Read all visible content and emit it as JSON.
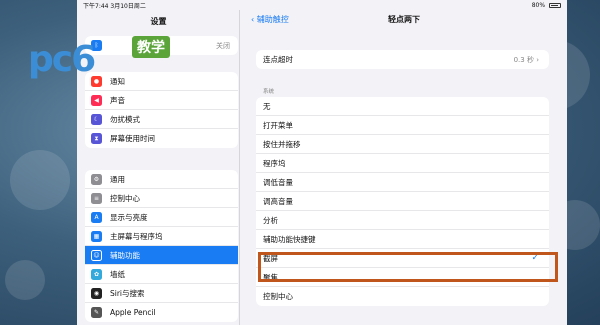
{
  "status": {
    "time": "下午7:44",
    "date": "3月10日周二",
    "battery": "80%"
  },
  "left": {
    "title": "设置",
    "bluetooth": {
      "value": "关闭"
    },
    "group1": [
      {
        "label": "通知",
        "icon": "bell-icon",
        "color": "#ff3b30"
      },
      {
        "label": "声音",
        "icon": "speaker-icon",
        "color": "#ff2d55"
      },
      {
        "label": "勿扰模式",
        "icon": "moon-icon",
        "color": "#5856d6"
      },
      {
        "label": "屏幕使用时间",
        "icon": "hourglass-icon",
        "color": "#5856d6"
      }
    ],
    "group2": [
      {
        "label": "通用",
        "icon": "gear-icon",
        "color": "#8e8e93"
      },
      {
        "label": "控制中心",
        "icon": "switches-icon",
        "color": "#8e8e93"
      },
      {
        "label": "显示与亮度",
        "icon": "aa-icon",
        "color": "#1a7cf3"
      },
      {
        "label": "主屏幕与程序坞",
        "icon": "grid-icon",
        "color": "#1a7cf3"
      },
      {
        "label": "辅助功能",
        "icon": "accessibility-icon",
        "color": "#1a7cf3"
      },
      {
        "label": "墙纸",
        "icon": "flower-icon",
        "color": "#34aadc"
      },
      {
        "label": "Siri与搜索",
        "icon": "siri-icon",
        "color": "#222222"
      },
      {
        "label": "Apple Pencil",
        "icon": "pencil-icon",
        "color": "#555555"
      }
    ]
  },
  "right": {
    "back_label": "辅助触控",
    "title": "轻点两下",
    "timeout": {
      "label": "连点超时",
      "value": "0.3 秒"
    },
    "section_label": "系统",
    "actions": [
      "无",
      "打开菜单",
      "按住并拖移",
      "程序坞",
      "调低音量",
      "调高音量",
      "分析",
      "辅助功能快捷键",
      "截屏",
      "聚焦",
      "控制中心"
    ],
    "selected": "截屏"
  },
  "logo": {
    "text": "pc6",
    "badge": "教学"
  }
}
